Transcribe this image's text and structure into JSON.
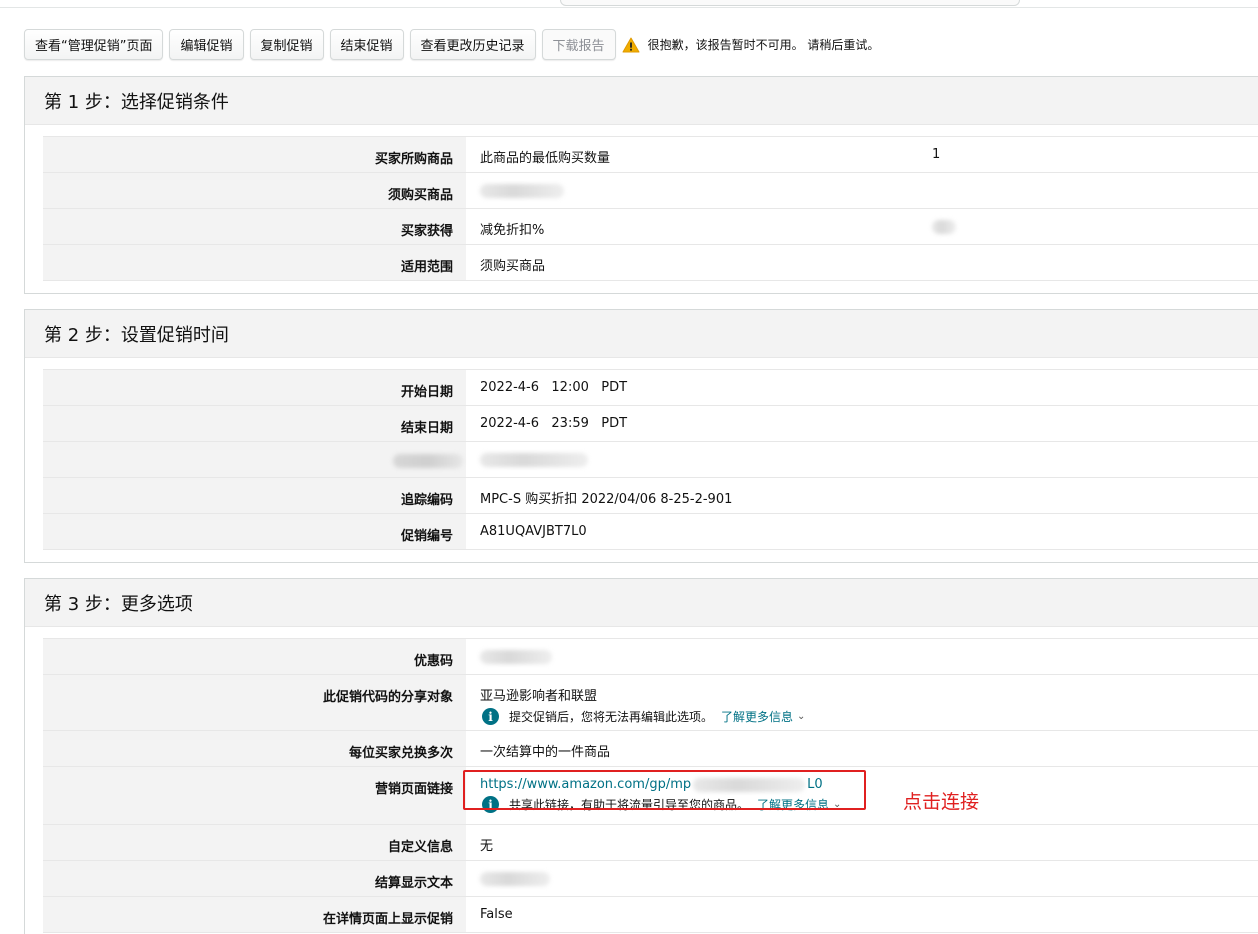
{
  "toolbar": {
    "view_manage": "查看“管理促销”页面",
    "edit": "编辑促销",
    "copy": "复制促销",
    "end": "结束促销",
    "history": "查看更改历史记录",
    "download": "下载报告",
    "warning": "很抱歉，该报告暂时不可用。 请稍后重试。"
  },
  "step1": {
    "title": "第 1 步：选择促销条件",
    "rows": [
      {
        "label": "买家所购商品",
        "value": "此商品的最低购买数量",
        "value2": "1"
      },
      {
        "label": "须购买商品",
        "value": ""
      },
      {
        "label": "买家获得",
        "value": "减免折扣%"
      },
      {
        "label": "适用范围",
        "value": "须购买商品"
      }
    ]
  },
  "step2": {
    "title": "第 2 步：设置促销时间",
    "rows": [
      {
        "label": "开始日期",
        "value": "2022-4-6   12:00   PDT"
      },
      {
        "label": "结束日期",
        "value": "2022-4-6   23:59   PDT"
      },
      {
        "label": "",
        "value": ""
      },
      {
        "label": "追踪编码",
        "value": "MPC-S 购买折扣 2022/04/06 8-25-2-901"
      },
      {
        "label": "促销编号",
        "value": "A81UQAVJBT7L0"
      }
    ]
  },
  "step3": {
    "title": "第 3 步：更多选项",
    "rows": [
      {
        "label": "优惠码",
        "value": ""
      },
      {
        "label": "此促销代码的分享对象",
        "value": "亚马逊影响者和联盟",
        "info": "提交促销后，您将无法再编辑此选项。",
        "info_link": "了解更多信息"
      },
      {
        "label": "每位买家兑换多次",
        "value": "一次结算中的一件商品"
      },
      {
        "label": "营销页面链接",
        "link_start": "https://www.amazon.com/gp/mp",
        "link_end": "L0",
        "info": "共享此链接，有助于将流量引导至您的商品。",
        "info_link": "了解更多信息"
      },
      {
        "label": "自定义信息",
        "value": "无"
      },
      {
        "label": "结算显示文本",
        "value": ""
      },
      {
        "label": "在详情页面上显示促销",
        "value": "False"
      }
    ]
  },
  "annotation": "点击连接",
  "colors": {
    "link": "#007185",
    "annotation": "#e02020",
    "warning": "#f0ad00"
  }
}
